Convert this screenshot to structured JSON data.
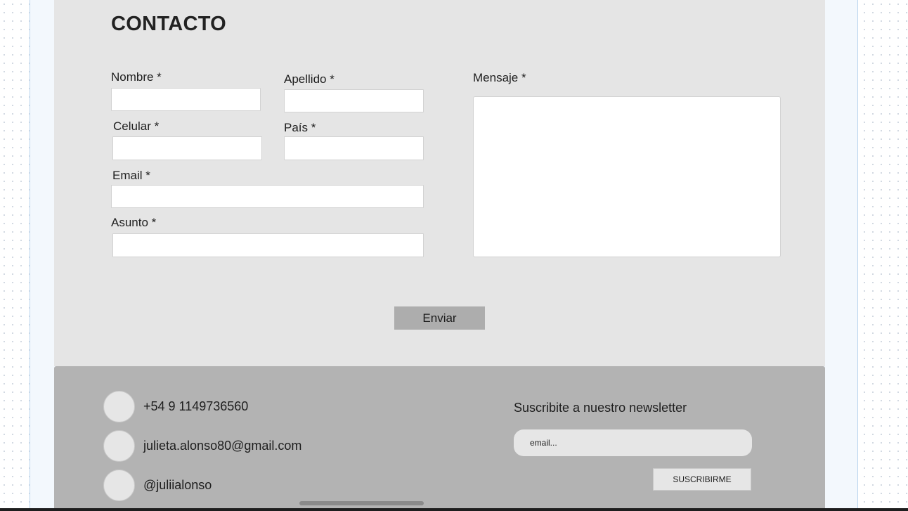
{
  "contact": {
    "title": "CONTACTO",
    "fields": {
      "nombre": {
        "label": "Nombre *",
        "value": ""
      },
      "apellido": {
        "label": "Apellido *",
        "value": ""
      },
      "celular": {
        "label": "Celular *",
        "value": ""
      },
      "pais": {
        "label": "País *",
        "value": ""
      },
      "email": {
        "label": "Email *",
        "value": ""
      },
      "asunto": {
        "label": "Asunto *",
        "value": ""
      },
      "mensaje": {
        "label": "Mensaje *",
        "value": ""
      }
    },
    "submit_label": "Enviar"
  },
  "footer": {
    "phone": "+54 9 1149736560",
    "email": "julieta.alonso80@gmail.com",
    "social": "@juliialonso",
    "newsletter": {
      "title": "Suscribite a nuestro newsletter",
      "placeholder": "email...",
      "button_label": "SUSCRIBIRME"
    }
  },
  "colors": {
    "contact_bg": "#e5e5e5",
    "footer_bg": "#b3b3b3",
    "button_bg": "#adadad"
  }
}
